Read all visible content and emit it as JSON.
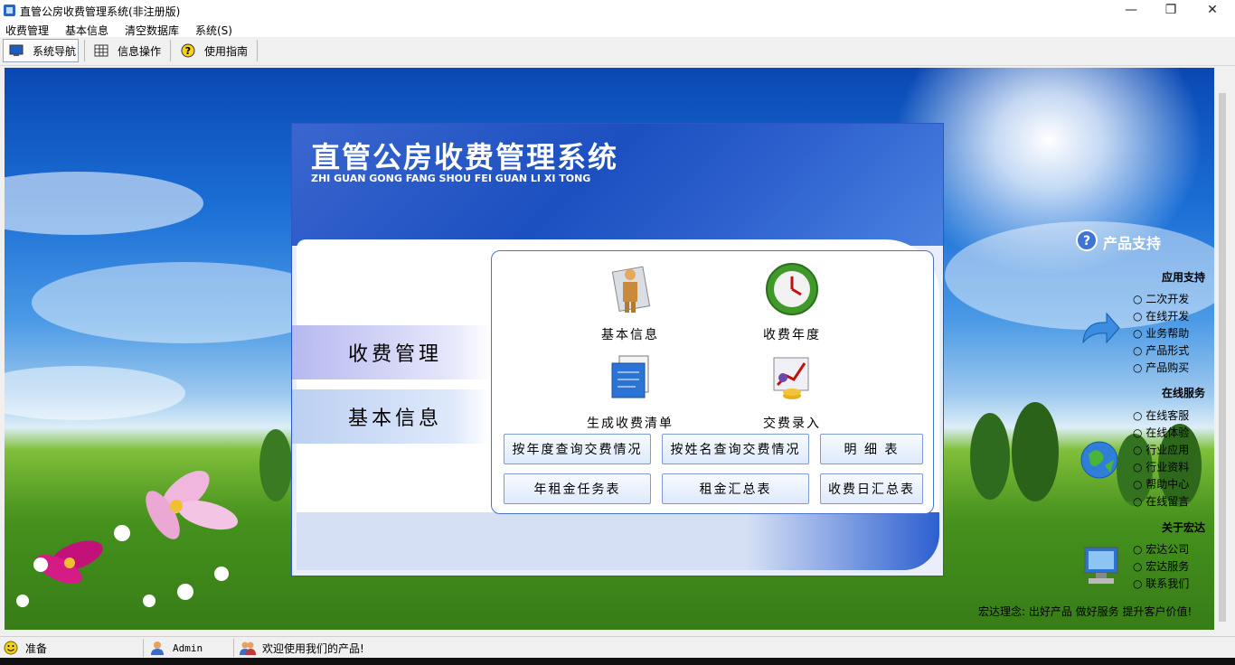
{
  "window": {
    "title": "直管公房收费管理系统(非注册版)"
  },
  "menu": [
    "收费管理",
    "基本信息",
    "清空数据库",
    "系统(S)"
  ],
  "toolbar": {
    "nav": "系统导航",
    "info": "信息操作",
    "guide": "使用指南"
  },
  "panel": {
    "title": "直管公房收费管理系统",
    "subtitle": "ZHI GUAN GONG FANG SHOU FEI GUAN LI XI TONG",
    "tabs": [
      "收费管理",
      "基本信息"
    ],
    "features": [
      "基本信息",
      "收费年度",
      "生成收费清单",
      "交费录入"
    ],
    "buttons": [
      "按年度查询交费情况",
      "按姓名查询交费情况",
      "明  细  表",
      "年租金任务表",
      "租金汇总表",
      "收费日汇总表"
    ]
  },
  "support": {
    "title": "产品支持",
    "app_title": "应用支持",
    "app_links": [
      "二次开发",
      "在线开发",
      "业务帮助",
      "产品形式",
      "产品购买"
    ],
    "online_title": "在线服务",
    "online_links": [
      "在线客服",
      "在线体验",
      "行业应用",
      "行业资料",
      "帮助中心",
      "在线留言"
    ],
    "about_title": "关于宏达",
    "about_links": [
      "宏达公司",
      "宏达服务",
      "联系我们"
    ],
    "slogan": "宏达理念: 出好产品 做好服务 提升客户价值!"
  },
  "status": {
    "ready": "准备",
    "user": "Admin",
    "welcome": "欢迎使用我们的产品!"
  },
  "colors": {
    "panel_blue": "#1c4fc0",
    "button_border": "#7f9bd4"
  }
}
